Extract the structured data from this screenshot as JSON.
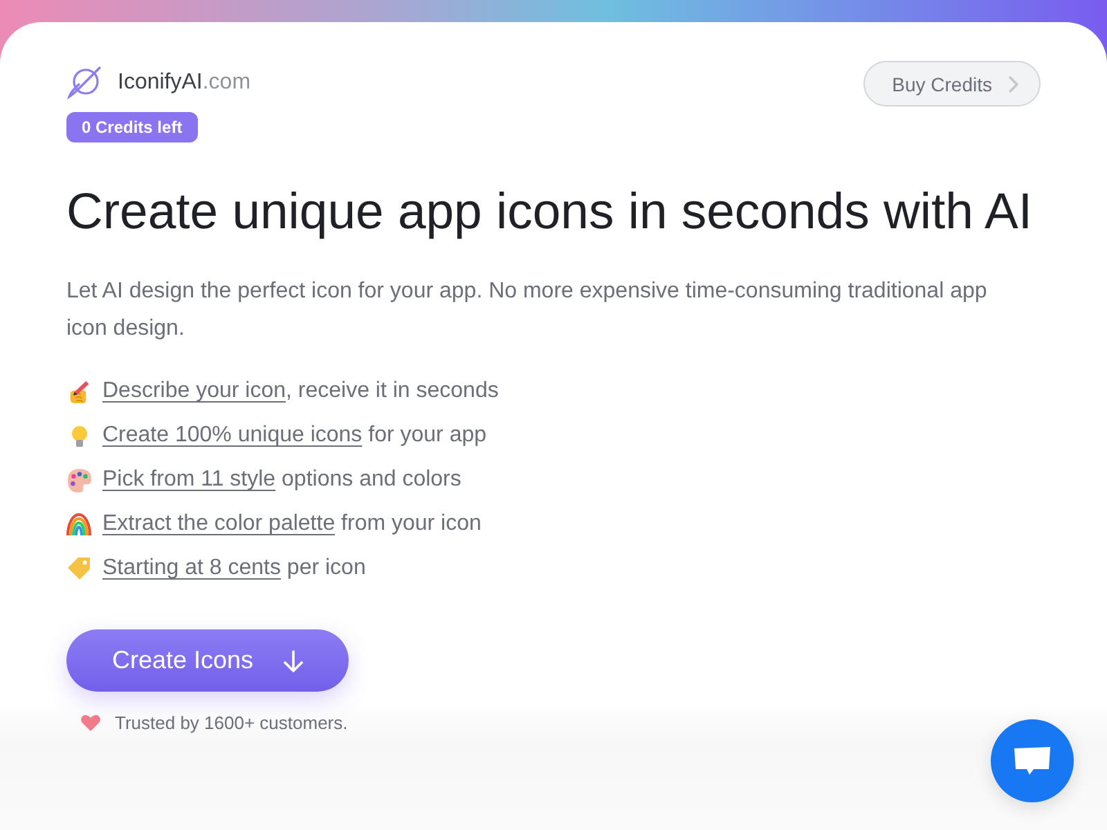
{
  "brand": {
    "name": "IconifyAI",
    "suffix": ".com"
  },
  "credits_badge": "0 Credits left",
  "buy_button": "Buy Credits",
  "heading": "Create unique app icons in seconds with AI",
  "intro": "Let AI design the perfect icon for your app. No more expensive time-consuming traditional app icon design.",
  "features": [
    {
      "link": "Describe your icon",
      "text": ", receive it in seconds"
    },
    {
      "link": "Create 100% unique icons",
      "text": " for your app"
    },
    {
      "link": "Pick from 11 style",
      "text": " options and colors"
    },
    {
      "link": "Extract the color palette",
      "text": " from your icon"
    },
    {
      "link": "Starting at 8 cents",
      "text": " per icon"
    }
  ],
  "cta_button": "Create Icons",
  "trust_note": "Trusted by 1600+ customers."
}
